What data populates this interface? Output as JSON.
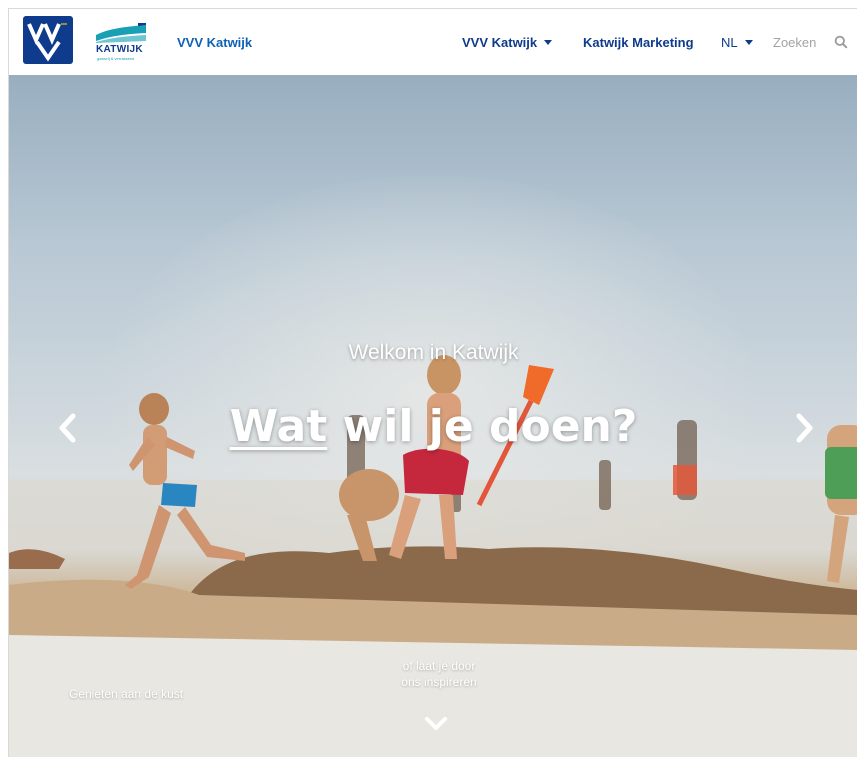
{
  "header": {
    "logo_vvv_alt": "VVV",
    "logo_katwijk_wordmark": "KATWIJK",
    "logo_katwijk_tagline": "gastvrij & verrassend",
    "site_title": "VVV Katwijk",
    "nav": {
      "vvv_katwijk": "VVV Katwijk",
      "katwijk_marketing": "Katwijk Marketing",
      "language": "NL"
    },
    "search": {
      "placeholder": "Zoeken",
      "icon": "search-icon"
    }
  },
  "hero": {
    "subtitle": "Welkom in Katwijk",
    "title_underlined": "Wat",
    "title_rest": " wil je doen?",
    "caption_left": "Genieten aan de kust",
    "caption_center_line1": "of laat je door",
    "caption_center_line2": "ons inspireren",
    "icons": {
      "prev": "chevron-left-icon",
      "next": "chevron-right-icon",
      "down": "chevron-down-icon"
    }
  },
  "colors": {
    "brand_navy": "#0e3b8c",
    "brand_blue": "#0e61b5",
    "brand_teal": "#1aa0b5"
  }
}
